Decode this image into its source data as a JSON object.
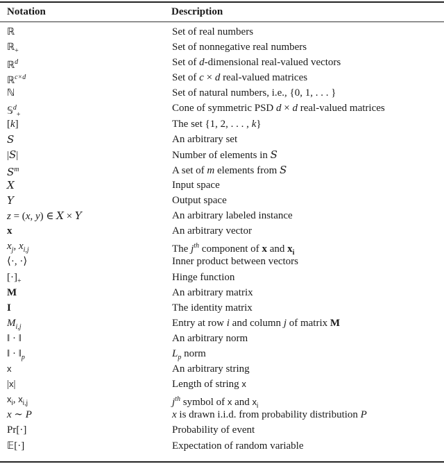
{
  "table": {
    "headers": {
      "notation": "Notation",
      "description": "Description"
    },
    "rows": [
      {
        "notation": [
          {
            "t": "ℝ",
            "s": "bb"
          }
        ],
        "description": [
          {
            "t": "Set of real numbers"
          }
        ]
      },
      {
        "notation": [
          {
            "t": "ℝ",
            "s": "bb"
          },
          {
            "t": "+",
            "s": "sub"
          }
        ],
        "description": [
          {
            "t": "Set of nonnegative real numbers"
          }
        ]
      },
      {
        "notation": [
          {
            "t": "ℝ",
            "s": "bb"
          },
          {
            "t": "d",
            "s": "sup i"
          }
        ],
        "description": [
          {
            "t": "Set of "
          },
          {
            "t": "d",
            "s": "i"
          },
          {
            "t": "-dimensional real-valued vectors"
          }
        ]
      },
      {
        "notation": [
          {
            "t": "ℝ",
            "s": "bb"
          },
          {
            "t": "c×d",
            "s": "sup i"
          }
        ],
        "description": [
          {
            "t": "Set of "
          },
          {
            "t": "c",
            "s": "i"
          },
          {
            "t": " × "
          },
          {
            "t": "d",
            "s": "i"
          },
          {
            "t": " real-valued matrices"
          }
        ]
      },
      {
        "notation": [
          {
            "t": "ℕ",
            "s": "bb"
          }
        ],
        "description": [
          {
            "t": "Set of natural numbers, i.e., {0, 1, . . . }"
          }
        ]
      },
      {
        "notation": [
          {
            "t": "𝕊",
            "s": "bb"
          },
          {
            "t": "d",
            "s": "sup i"
          },
          {
            "t": "+",
            "s": "sub"
          }
        ],
        "description": [
          {
            "t": "Cone of symmetric PSD "
          },
          {
            "t": "d",
            "s": "i"
          },
          {
            "t": " × "
          },
          {
            "t": "d",
            "s": "i"
          },
          {
            "t": " real-valued matrices"
          }
        ]
      },
      {
        "notation": [
          {
            "t": "["
          },
          {
            "t": "k",
            "s": "i"
          },
          {
            "t": "]"
          }
        ],
        "description": [
          {
            "t": "The set {1, 2, . . . , "
          },
          {
            "t": "k",
            "s": "i"
          },
          {
            "t": "}"
          }
        ]
      },
      {
        "notation": [
          {
            "t": "S",
            "s": "cal"
          }
        ],
        "description": [
          {
            "t": "An arbitrary set"
          }
        ]
      },
      {
        "notation": [
          {
            "t": "|"
          },
          {
            "t": "S",
            "s": "cal"
          },
          {
            "t": "|"
          }
        ],
        "description": [
          {
            "t": "Number of elements in "
          },
          {
            "t": "S",
            "s": "cal"
          }
        ]
      },
      {
        "notation": [
          {
            "t": "S",
            "s": "cal"
          },
          {
            "t": "m",
            "s": "sup i"
          }
        ],
        "description": [
          {
            "t": "A set of "
          },
          {
            "t": "m",
            "s": "i"
          },
          {
            "t": " elements from "
          },
          {
            "t": "S",
            "s": "cal"
          }
        ]
      },
      {
        "notation": [
          {
            "t": "X",
            "s": "cal"
          }
        ],
        "description": [
          {
            "t": "Input space"
          }
        ]
      },
      {
        "notation": [
          {
            "t": "Y",
            "s": "cal"
          }
        ],
        "description": [
          {
            "t": "Output space"
          }
        ]
      },
      {
        "notation": [
          {
            "t": "z",
            "s": "i"
          },
          {
            "t": " = ("
          },
          {
            "t": "x",
            "s": "i"
          },
          {
            "t": ", "
          },
          {
            "t": "y",
            "s": "i"
          },
          {
            "t": ") ∈ "
          },
          {
            "t": "X",
            "s": "cal"
          },
          {
            "t": " × "
          },
          {
            "t": "Y",
            "s": "cal"
          }
        ],
        "description": [
          {
            "t": "An arbitrary labeled instance"
          }
        ]
      },
      {
        "notation": [
          {
            "t": "x",
            "s": "b"
          }
        ],
        "description": [
          {
            "t": "An arbitrary vector"
          }
        ]
      },
      {
        "notation": [
          {
            "t": "x",
            "s": "i"
          },
          {
            "t": "j",
            "s": "sub i"
          },
          {
            "t": ", "
          },
          {
            "t": "x",
            "s": "i"
          },
          {
            "t": "i,j",
            "s": "sub i"
          }
        ],
        "description": [
          {
            "t": "The "
          },
          {
            "t": "j",
            "s": "i"
          },
          {
            "t": "th",
            "s": "sup i"
          },
          {
            "t": " component of "
          },
          {
            "t": "x",
            "s": "b"
          },
          {
            "t": " and "
          },
          {
            "t": "x",
            "s": "b"
          },
          {
            "t": "i",
            "s": "sub b"
          }
        ]
      },
      {
        "notation": [
          {
            "t": "⟨·, ·⟩"
          }
        ],
        "description": [
          {
            "t": "Inner product between vectors"
          }
        ]
      },
      {
        "notation": [
          {
            "t": "[·]"
          },
          {
            "t": "+",
            "s": "sub"
          }
        ],
        "description": [
          {
            "t": "Hinge function"
          }
        ]
      },
      {
        "notation": [
          {
            "t": "M",
            "s": "b"
          }
        ],
        "description": [
          {
            "t": "An arbitrary matrix"
          }
        ]
      },
      {
        "notation": [
          {
            "t": "I",
            "s": "b"
          }
        ],
        "description": [
          {
            "t": "The identity matrix"
          }
        ]
      },
      {
        "notation": [
          {
            "t": "M",
            "s": "i"
          },
          {
            "t": "i,j",
            "s": "sub i"
          }
        ],
        "description": [
          {
            "t": "Entry at row "
          },
          {
            "t": "i",
            "s": "i"
          },
          {
            "t": " and column "
          },
          {
            "t": "j",
            "s": "i"
          },
          {
            "t": " of matrix "
          },
          {
            "t": "M",
            "s": "b"
          }
        ]
      },
      {
        "notation": [
          {
            "t": "‖ · ‖"
          }
        ],
        "description": [
          {
            "t": "An arbitrary norm"
          }
        ]
      },
      {
        "notation": [
          {
            "t": "‖ · ‖"
          },
          {
            "t": "p",
            "s": "sub i"
          }
        ],
        "description": [
          {
            "t": "L",
            "s": "i"
          },
          {
            "t": "p",
            "s": "sub i"
          },
          {
            "t": " norm"
          }
        ]
      },
      {
        "notation": [
          {
            "t": "x",
            "s": "s"
          }
        ],
        "description": [
          {
            "t": "An arbitrary string"
          }
        ]
      },
      {
        "notation": [
          {
            "t": "|"
          },
          {
            "t": "x",
            "s": "s"
          },
          {
            "t": "|"
          }
        ],
        "description": [
          {
            "t": "Length of string "
          },
          {
            "t": "x",
            "s": "s"
          }
        ]
      },
      {
        "notation": [
          {
            "t": "x",
            "s": "s"
          },
          {
            "t": "i",
            "s": "sub s"
          },
          {
            "t": ", "
          },
          {
            "t": "x",
            "s": "s"
          },
          {
            "t": "i,j",
            "s": "sub s"
          }
        ],
        "description": [
          {
            "t": "j",
            "s": "i"
          },
          {
            "t": "th",
            "s": "sup i"
          },
          {
            "t": " symbol of "
          },
          {
            "t": "x",
            "s": "s"
          },
          {
            "t": " and "
          },
          {
            "t": "x",
            "s": "s"
          },
          {
            "t": "i",
            "s": "sub s"
          }
        ]
      },
      {
        "notation": [
          {
            "t": "x",
            "s": "i"
          },
          {
            "t": " ∼ "
          },
          {
            "t": "P",
            "s": "i"
          }
        ],
        "description": [
          {
            "t": "x",
            "s": "i"
          },
          {
            "t": " is drawn i.i.d. from probability distribution "
          },
          {
            "t": "P",
            "s": "i"
          }
        ]
      },
      {
        "notation": [
          {
            "t": "Pr[·]"
          }
        ],
        "description": [
          {
            "t": "Probability of event"
          }
        ]
      },
      {
        "notation": [
          {
            "t": "𝔼",
            "s": "bb"
          },
          {
            "t": "[·]"
          }
        ],
        "description": [
          {
            "t": "Expectation of random variable"
          }
        ]
      }
    ]
  }
}
